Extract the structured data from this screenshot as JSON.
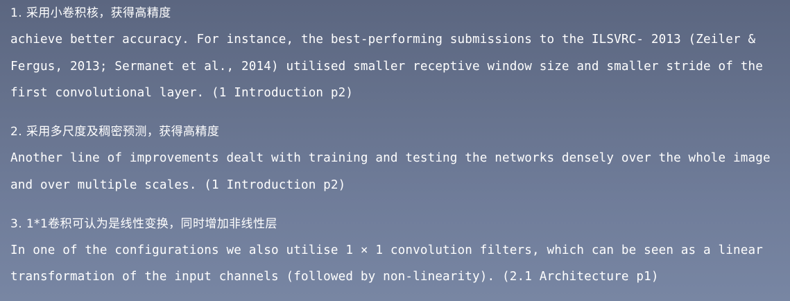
{
  "sections": [
    {
      "heading": "1. 采用小卷积核，获得高精度",
      "lines": [
        "achieve better accuracy. For instance, the best-performing submissions to the ILSVRC- 2013 (Zeiler &",
        "Fergus, 2013; Sermanet et al., 2014) utilised smaller receptive window size and smaller stride of the",
        "first convolutional layer.  (1 Introduction p2)"
      ]
    },
    {
      "heading": "2. 采用多尺度及稠密预测，获得高精度",
      "lines": [
        "Another line of improvements dealt with training and testing the networks densely over the whole image",
        "and over multiple scales. (1 Introduction p2)"
      ]
    },
    {
      "heading": "3. 1*1卷积可认为是线性变换，同时增加非线性层",
      "lines": [
        "In one of the configurations we also utilise 1 × 1 convolution filters, which can be seen as a linear",
        "transformation of the input channels (followed by non-linearity). (2.1 Architecture p1)"
      ]
    }
  ]
}
